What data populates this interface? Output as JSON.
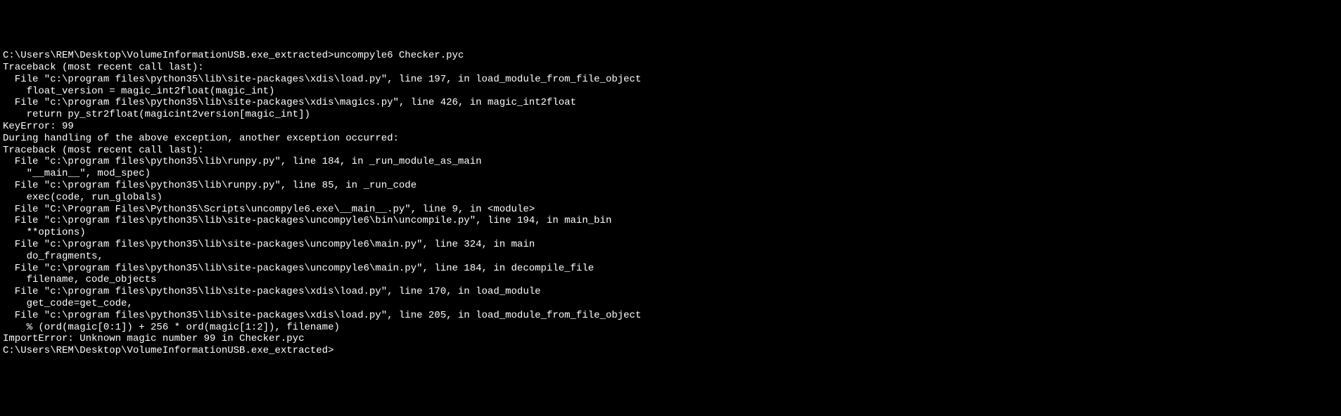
{
  "terminal": {
    "lines": [
      "C:\\Users\\REM\\Desktop\\VolumeInformationUSB.exe_extracted>uncompyle6 Checker.pyc",
      "Traceback (most recent call last):",
      "  File \"c:\\program files\\python35\\lib\\site-packages\\xdis\\load.py\", line 197, in load_module_from_file_object",
      "    float_version = magic_int2float(magic_int)",
      "  File \"c:\\program files\\python35\\lib\\site-packages\\xdis\\magics.py\", line 426, in magic_int2float",
      "    return py_str2float(magicint2version[magic_int])",
      "KeyError: 99",
      "",
      "During handling of the above exception, another exception occurred:",
      "",
      "Traceback (most recent call last):",
      "  File \"c:\\program files\\python35\\lib\\runpy.py\", line 184, in _run_module_as_main",
      "    \"__main__\", mod_spec)",
      "  File \"c:\\program files\\python35\\lib\\runpy.py\", line 85, in _run_code",
      "    exec(code, run_globals)",
      "  File \"C:\\Program Files\\Python35\\Scripts\\uncompyle6.exe\\__main__.py\", line 9, in <module>",
      "  File \"c:\\program files\\python35\\lib\\site-packages\\uncompyle6\\bin\\uncompile.py\", line 194, in main_bin",
      "    **options)",
      "  File \"c:\\program files\\python35\\lib\\site-packages\\uncompyle6\\main.py\", line 324, in main",
      "    do_fragments,",
      "  File \"c:\\program files\\python35\\lib\\site-packages\\uncompyle6\\main.py\", line 184, in decompile_file",
      "    filename, code_objects",
      "  File \"c:\\program files\\python35\\lib\\site-packages\\xdis\\load.py\", line 170, in load_module",
      "    get_code=get_code,",
      "  File \"c:\\program files\\python35\\lib\\site-packages\\xdis\\load.py\", line 205, in load_module_from_file_object",
      "    % (ord(magic[0:1]) + 256 * ord(magic[1:2]), filename)",
      "ImportError: Unknown magic number 99 in Checker.pyc",
      "",
      "C:\\Users\\REM\\Desktop\\VolumeInformationUSB.exe_extracted>"
    ]
  }
}
